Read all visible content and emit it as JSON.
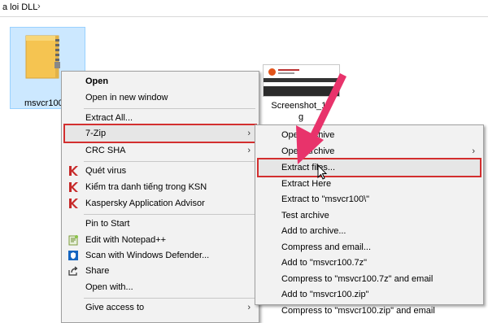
{
  "explorer": {
    "breadcrumb": "a loi DLL",
    "files": [
      {
        "label": "msvcr100"
      },
      {
        "label": "Screenshot_11",
        "label_line2": "g"
      }
    ]
  },
  "main_menu": {
    "items": [
      {
        "label": "Open",
        "bold": true
      },
      {
        "label": "Open in new window"
      },
      {
        "label": "Extract All..."
      },
      {
        "label": "7-Zip"
      },
      {
        "label": "CRC SHA"
      },
      {
        "label": "Quét virus"
      },
      {
        "label": "Kiểm tra danh tiếng trong KSN"
      },
      {
        "label": "Kaspersky Application Advisor"
      },
      {
        "label": "Pin to Start"
      },
      {
        "label": "Edit with Notepad++"
      },
      {
        "label": "Scan with Windows Defender..."
      },
      {
        "label": "Share"
      },
      {
        "label": "Open with..."
      },
      {
        "label": "Give access to"
      }
    ]
  },
  "sub_menu": {
    "items": [
      {
        "label": "Open archive"
      },
      {
        "label": "Open archive"
      },
      {
        "label": "Extract files..."
      },
      {
        "label": "Extract Here"
      },
      {
        "label": "Extract to \"msvcr100\\\""
      },
      {
        "label": "Test archive"
      },
      {
        "label": "Add to archive..."
      },
      {
        "label": "Compress and email..."
      },
      {
        "label": "Add to \"msvcr100.7z\""
      },
      {
        "label": "Compress to \"msvcr100.7z\" and email"
      },
      {
        "label": "Add to \"msvcr100.zip\""
      },
      {
        "label": "Compress to \"msvcr100.zip\" and email"
      }
    ]
  },
  "colors": {
    "highlight": "#d32f2f",
    "pink_arrow": "#e8336b",
    "selection": "#cce8ff"
  }
}
